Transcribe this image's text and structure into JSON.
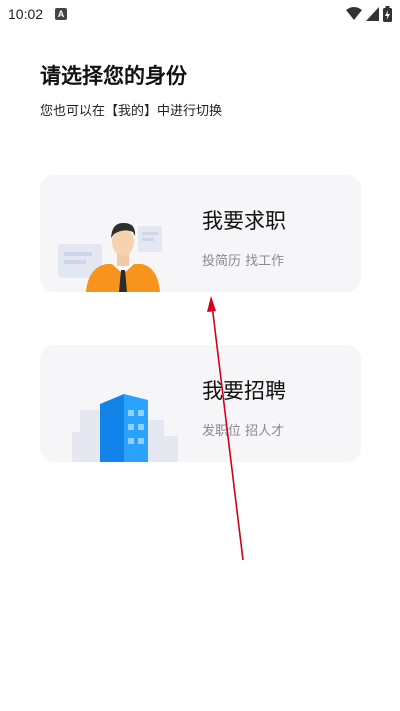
{
  "status_bar": {
    "time": "10:02",
    "notification_icon": "a-badge-icon",
    "icons": [
      "wifi-icon",
      "signal-icon",
      "battery-icon"
    ]
  },
  "header": {
    "title": "请选择您的身份",
    "subtitle": "您也可以在【我的】中进行切换"
  },
  "options": [
    {
      "title": "我要求职",
      "subtitle": "投简历 找工作",
      "icon": "job-seeker-icon"
    },
    {
      "title": "我要招聘",
      "subtitle": "发职位 招人才",
      "icon": "company-building-icon"
    }
  ],
  "colors": {
    "card_bg": "#f6f6f8",
    "accent_orange": "#f7941d",
    "accent_blue": "#1890ff",
    "annotation_red": "#d0021b"
  }
}
